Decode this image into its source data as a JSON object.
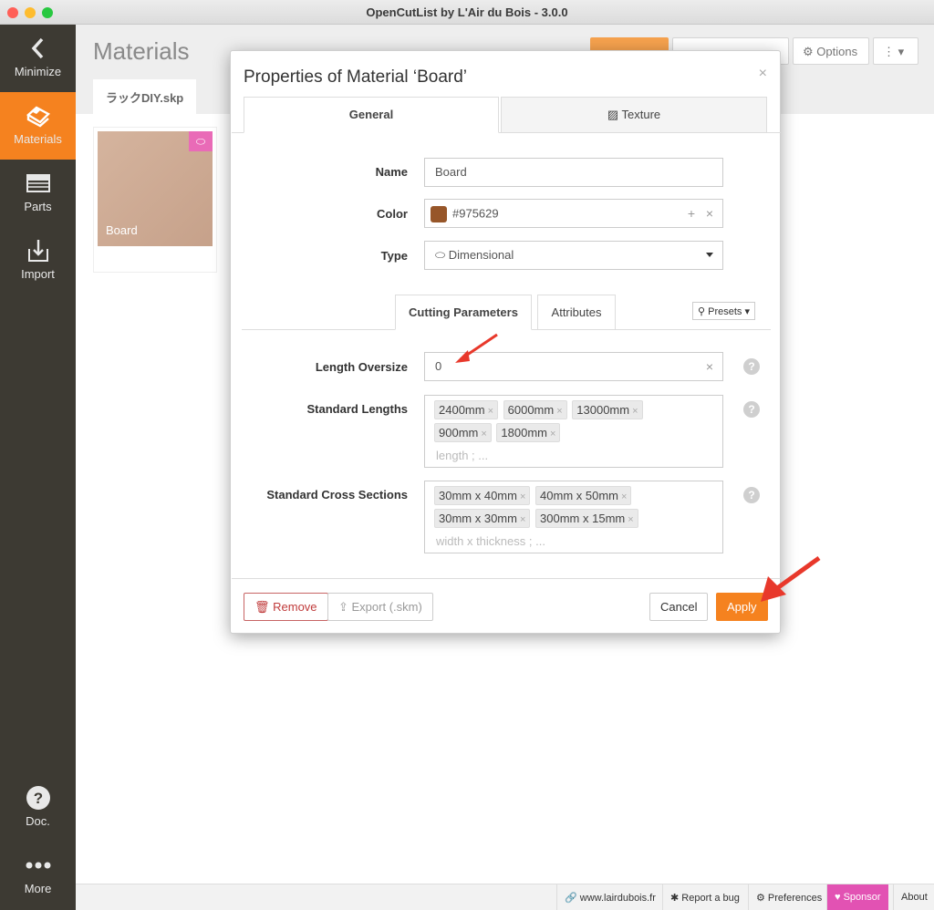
{
  "window": {
    "title": "OpenCutList by L'Air du Bois - 3.0.0"
  },
  "sidebar": {
    "items": [
      {
        "label": "Minimize",
        "icon": "chevron-left-icon"
      },
      {
        "label": "Materials",
        "icon": "materials-icon"
      },
      {
        "label": "Parts",
        "icon": "parts-icon"
      },
      {
        "label": "Import",
        "icon": "import-icon"
      },
      {
        "label": "Doc.",
        "icon": "help-icon"
      },
      {
        "label": "More",
        "icon": "more-icon"
      }
    ]
  },
  "main": {
    "title": "Materials",
    "file_tab": "ラックDIY.skp",
    "options_label": "Options",
    "material_card": {
      "label": "Board"
    }
  },
  "statusbar": {
    "website": "www.lairdubois.fr",
    "report_bug": "Report a bug",
    "preferences": "Preferences",
    "sponsor": "Sponsor",
    "about": "About"
  },
  "modal": {
    "title": "Properties of Material ‘Board’",
    "tabs": {
      "general": "General",
      "texture": "Texture"
    },
    "fields": {
      "name_label": "Name",
      "name_value": "Board",
      "color_label": "Color",
      "color_value": "#975629",
      "type_label": "Type",
      "type_value": "Dimensional"
    },
    "subtabs": {
      "cutting": "Cutting Parameters",
      "attributes": "Attributes",
      "presets": "Presets"
    },
    "length_oversize": {
      "label": "Length Oversize",
      "value": "0"
    },
    "standard_lengths": {
      "label": "Standard Lengths",
      "chips": [
        "2400mm",
        "6000mm",
        "13000mm",
        "900mm",
        "1800mm"
      ],
      "placeholder": "length ; ..."
    },
    "standard_cross_sections": {
      "label": "Standard Cross Sections",
      "chips": [
        "30mm x 40mm",
        "40mm x 50mm",
        "30mm x 30mm",
        "300mm x 15mm"
      ],
      "placeholder": "width x thickness ; ..."
    },
    "buttons": {
      "remove": "Remove",
      "export": "Export (.skm)",
      "cancel": "Cancel",
      "apply": "Apply"
    }
  },
  "colors": {
    "accent": "#f5821f",
    "sidebar": "#3d3a33",
    "sponsor": "#e252b3",
    "swatch": "#975629",
    "annotation_arrow": "#e8382b"
  }
}
